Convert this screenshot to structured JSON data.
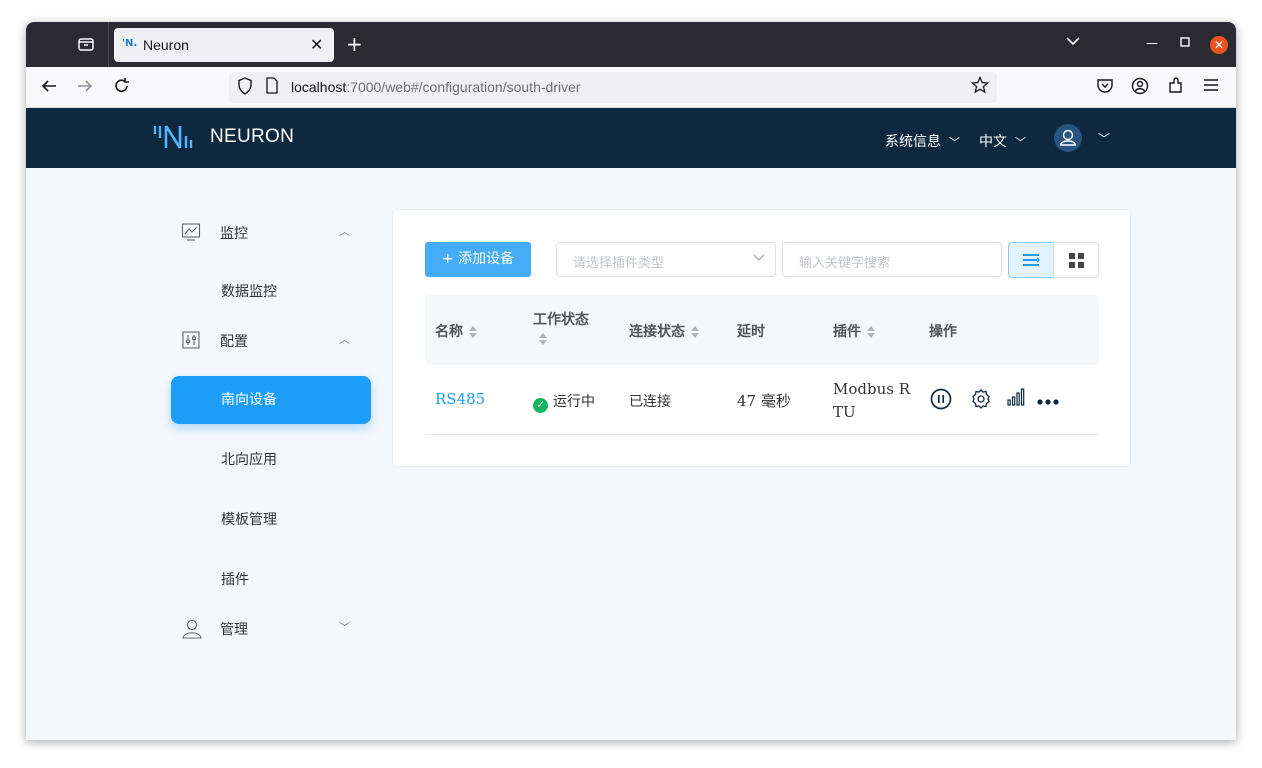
{
  "browser": {
    "tab_title": "Neuron",
    "tab_favicon_text": "'N.",
    "url_host": "localhost",
    "url_rest": ":7000/web#/configuration/south-driver"
  },
  "header": {
    "logo_text": "NEURON",
    "system_info": "系统信息",
    "language": "中文"
  },
  "sidebar": {
    "groups": [
      {
        "label": "监控",
        "icon": "monitor-chart-icon",
        "expanded": true,
        "items": [
          {
            "label": "数据监控"
          }
        ]
      },
      {
        "label": "配置",
        "icon": "config-sliders-icon",
        "expanded": true,
        "items": [
          {
            "label": "南向设备",
            "active": true
          },
          {
            "label": "北向应用"
          },
          {
            "label": "模板管理"
          },
          {
            "label": "插件"
          }
        ]
      },
      {
        "label": "管理",
        "icon": "user-icon",
        "expanded": false,
        "items": []
      }
    ]
  },
  "toolbar": {
    "add_label": "添加设备",
    "plugin_select_placeholder": "请选择插件类型",
    "search_placeholder": "输入关键字搜索"
  },
  "table": {
    "columns": [
      "名称",
      "工作状态",
      "连接状态",
      "延时",
      "插件",
      "操作"
    ],
    "rows": [
      {
        "name": "RS485",
        "work_status": "运行中",
        "conn_status": "已连接",
        "delay": "47 毫秒",
        "plugin_line1": "Modbus R",
        "plugin_line2": "TU"
      }
    ]
  },
  "colors": {
    "primary": "#1d9cf8",
    "header_bg": "#0e2840",
    "running": "#16b361"
  }
}
